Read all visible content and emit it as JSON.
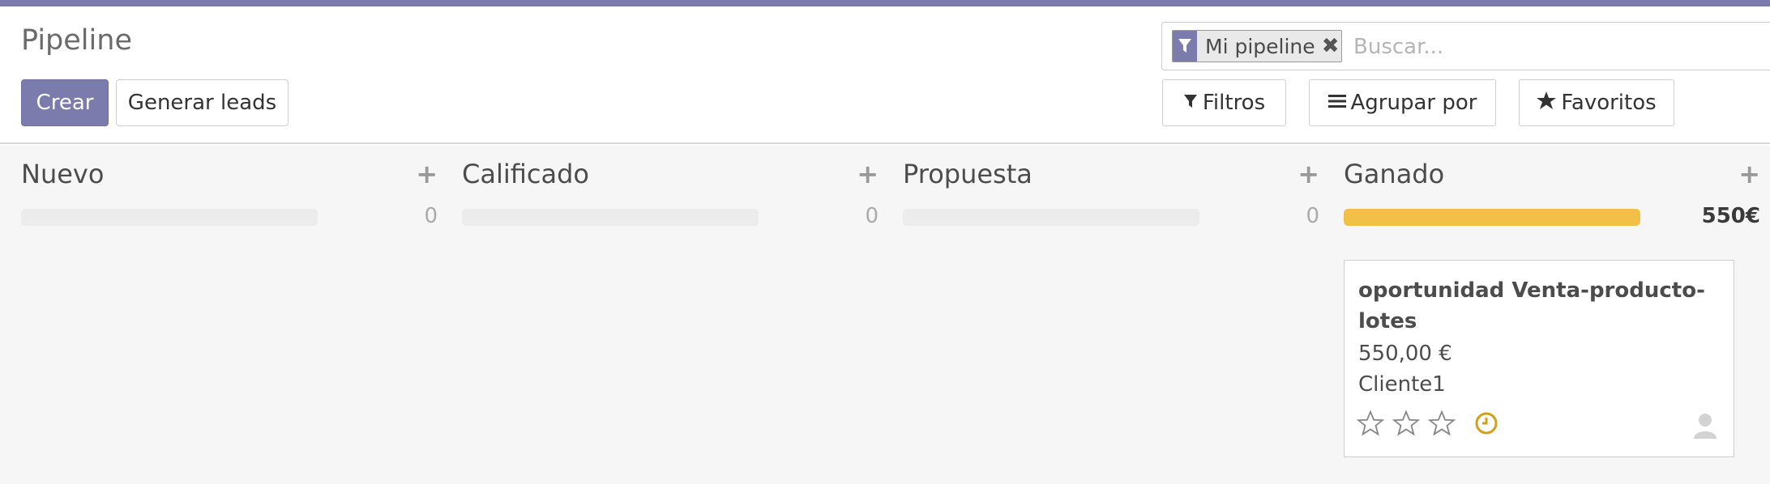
{
  "page": {
    "title": "Pipeline"
  },
  "buttons": {
    "create": "Crear",
    "generate_leads": "Generar leads"
  },
  "search": {
    "facet_label": "Mi pipeline",
    "facet_close": "✖",
    "placeholder": "Buscar..."
  },
  "search_buttons": {
    "filters": "Filtros",
    "group_by": "Agrupar por",
    "favorites": "Favoritos"
  },
  "colors": {
    "brand": "#7c7bad",
    "progress_won": "#f2c046",
    "activity_clock": "#d4a017"
  },
  "columns": [
    {
      "title": "Nuevo",
      "add": "+",
      "total": "0",
      "progress": 0
    },
    {
      "title": "Calificado",
      "add": "+",
      "total": "0",
      "progress": 0
    },
    {
      "title": "Propuesta",
      "add": "+",
      "total": "0",
      "progress": 0
    },
    {
      "title": "Ganado",
      "add": "+",
      "total": "550€",
      "progress": 1,
      "cards": [
        {
          "title": "oportunidad Venta-producto-lotes",
          "amount": "550,00 €",
          "customer": "Cliente1",
          "priority_stars": 3,
          "priority_value": 0,
          "activity_icon": "clock-icon",
          "assignee_icon": "user-avatar-icon"
        }
      ]
    }
  ]
}
